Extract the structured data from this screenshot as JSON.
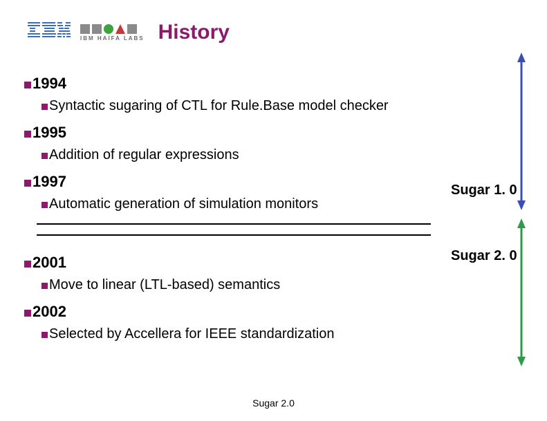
{
  "header": {
    "haifa_text": "IBM HAIFA LABS",
    "title": "History"
  },
  "timeline": {
    "y1994": {
      "year": "1994",
      "desc": "Syntactic sugaring of CTL for Rule.Base model checker"
    },
    "y1995": {
      "year": "1995",
      "desc": "Addition of regular expressions"
    },
    "y1997": {
      "year": "1997",
      "desc": "Automatic generation of simulation monitors"
    },
    "y2001": {
      "year": "2001",
      "desc": "Move to linear (LTL-based) semantics"
    },
    "y2002": {
      "year": "2002",
      "desc": "Selected by Accellera for IEEE standardization"
    }
  },
  "labels": {
    "sugar1": "Sugar 1. 0",
    "sugar2": "Sugar 2. 0"
  },
  "footer": "Sugar 2.0",
  "colors": {
    "accent": "#8b1a6b",
    "arrow1": "#3a4fb5",
    "arrow2": "#2e9a4a"
  }
}
